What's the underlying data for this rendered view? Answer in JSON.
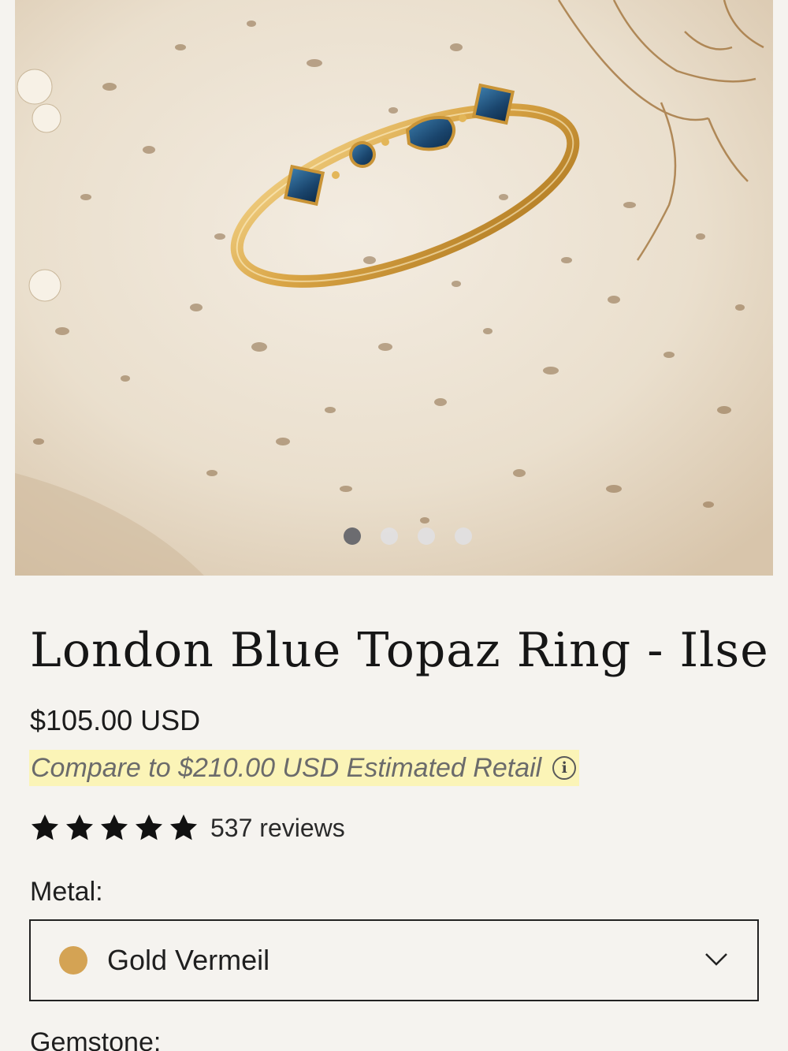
{
  "gallery": {
    "slides_total": 4,
    "active_slide": 1
  },
  "product": {
    "title": "London Blue Topaz Ring - Ilse",
    "price": "$105.00 USD",
    "compare_text": "Compare to $210.00 USD Estimated Retail",
    "info_icon": "info-circle-icon",
    "rating": {
      "stars": 5,
      "reviews_label": "537 reviews"
    }
  },
  "options": {
    "metal_label": "Metal:",
    "metal_value": "Gold Vermeil",
    "metal_swatch_color": "#d4a354",
    "gemstone_label": "Gemstone:"
  },
  "colors": {
    "background": "#f5f3ef",
    "highlight": "#fbf4b7",
    "active_dot": "#6c6c70",
    "inactive_dot": "#e1e1e4"
  }
}
